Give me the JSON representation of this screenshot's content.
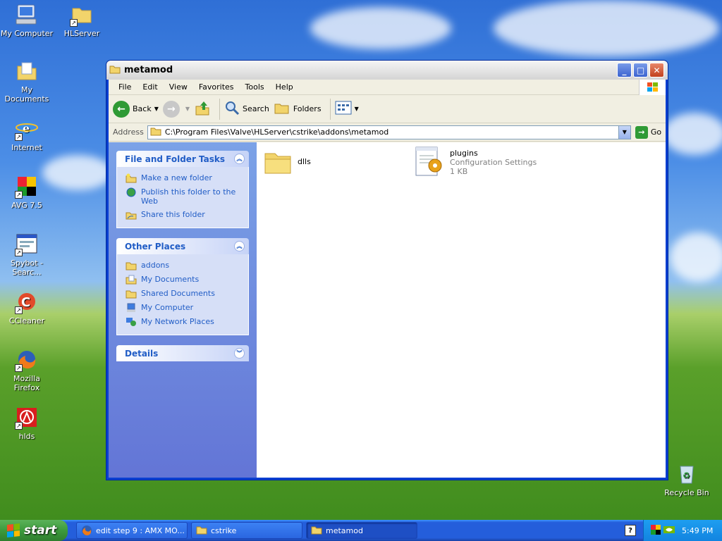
{
  "desktop": {
    "icons": [
      {
        "label": "My Computer",
        "icon": "my-computer-icon"
      },
      {
        "label": "HLServer",
        "icon": "folder-shortcut-icon"
      },
      {
        "label": "My Documents",
        "icon": "my-documents-icon"
      },
      {
        "label": "Internet",
        "icon": "internet-explorer-icon"
      },
      {
        "label": "AVG 7.5",
        "icon": "avg-icon"
      },
      {
        "label": "Spybot - Searc...",
        "icon": "spybot-icon"
      },
      {
        "label": "CCleaner",
        "icon": "ccleaner-icon"
      },
      {
        "label": "Mozilla Firefox",
        "icon": "firefox-icon"
      },
      {
        "label": "hlds",
        "icon": "hlds-icon"
      },
      {
        "label": "Recycle Bin",
        "icon": "recycle-bin-icon"
      }
    ]
  },
  "window": {
    "title": "metamod",
    "menu": [
      "File",
      "Edit",
      "View",
      "Favorites",
      "Tools",
      "Help"
    ],
    "toolbar": {
      "back": "Back",
      "search": "Search",
      "folders": "Folders"
    },
    "address": {
      "label": "Address",
      "value": "C:\\Program Files\\Valve\\HLServer\\cstrike\\addons\\metamod",
      "go": "Go"
    },
    "taskpane": {
      "file_tasks": {
        "title": "File and Folder Tasks",
        "items": [
          "Make a new folder",
          "Publish this folder to the Web",
          "Share this folder"
        ]
      },
      "other_places": {
        "title": "Other Places",
        "items": [
          "addons",
          "My Documents",
          "Shared Documents",
          "My Computer",
          "My Network Places"
        ]
      },
      "details": {
        "title": "Details"
      }
    },
    "files": [
      {
        "name": "dlls",
        "type": "",
        "size": ""
      },
      {
        "name": "plugins",
        "type": "Configuration Settings",
        "size": "1 KB"
      }
    ]
  },
  "taskbar": {
    "start": "start",
    "buttons": [
      "edit step 9 : AMX MO...",
      "cstrike",
      "metamod"
    ],
    "clock": "5:49 PM"
  },
  "colors": {
    "titlebar": "#e2e2e2",
    "taskpane": "#6f8fe0",
    "link": "#215dc6",
    "taskbar": "#245edb",
    "start": "#3c9a3c"
  }
}
